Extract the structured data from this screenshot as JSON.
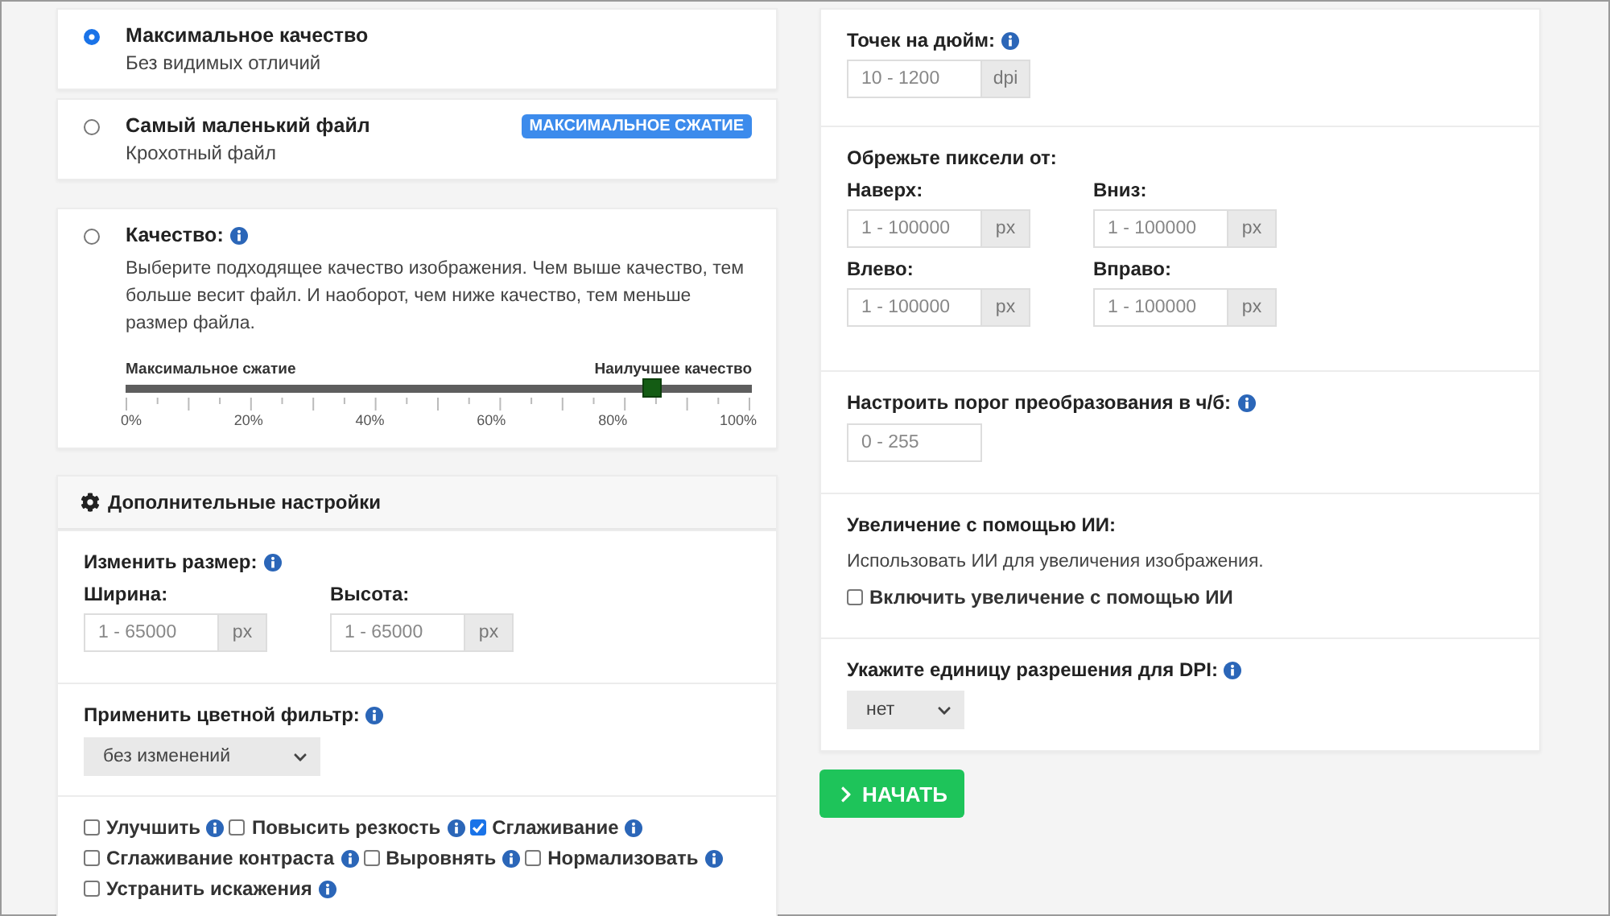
{
  "quality": {
    "options": [
      {
        "kind": "preset",
        "title": "Максимальное качество",
        "subtitle": "Без видимых отличий",
        "selected": true
      },
      {
        "kind": "preset",
        "title": "Самый маленький файл",
        "subtitle": "Крохотный файл",
        "badge": "МАКСИМАЛЬНОЕ СЖАТИЕ",
        "selected": false
      },
      {
        "kind": "custom",
        "title": "Качество:",
        "info": true,
        "description": "Выберите подходящее качество изображения. Чем выше качество, тем больше весит файл. И наоборот, чем ниже качество, тем меньше размер файла.",
        "slider": {
          "min_label": "Максимальное сжатие",
          "max_label": "Наилучшее качество",
          "level": 0.84,
          "scale": [
            "0%",
            "20%",
            "40%",
            "60%",
            "80%",
            "100%"
          ]
        },
        "selected": false
      }
    ]
  },
  "advanced": {
    "title": "Дополнительные настройки",
    "resize": {
      "label": "Изменить размер:",
      "info": true,
      "fields": [
        {
          "label": "Ширина:",
          "placeholder": "1 - 65000",
          "unit": "px"
        },
        {
          "label": "Высота:",
          "placeholder": "1 - 65000",
          "unit": "px"
        }
      ]
    },
    "color_filter": {
      "label": "Применить цветной фильтр:",
      "info": true,
      "value": "без изменений"
    },
    "options": [
      {
        "label": "Улучшить",
        "checked": false,
        "info": true
      },
      {
        "label": "Повысить резкость",
        "checked": false,
        "info": true
      },
      {
        "label": "Сглаживание",
        "checked": true,
        "info": true
      },
      {
        "label": "Сглаживание контраста",
        "checked": false,
        "info": true
      },
      {
        "label": "Выровнять",
        "checked": false,
        "info": true
      },
      {
        "label": "Нормализовать",
        "checked": false,
        "info": true
      },
      {
        "label": "Устранить искажения",
        "checked": false,
        "info": true
      }
    ]
  },
  "dpi": {
    "label": "Точек на дюйм:",
    "info": true,
    "placeholder": "10 - 1200",
    "unit": "dpi"
  },
  "crop": {
    "label": "Обрежьте пиксели от:",
    "fields": [
      {
        "label": "Наверх:",
        "placeholder": "1 - 100000",
        "unit": "px"
      },
      {
        "label": "Вниз:",
        "placeholder": "1 - 100000",
        "unit": "px"
      },
      {
        "label": "Влево:",
        "placeholder": "1 - 100000",
        "unit": "px"
      },
      {
        "label": "Вправо:",
        "placeholder": "1 - 100000",
        "unit": "px"
      }
    ]
  },
  "threshold": {
    "label": "Настроить порог преобразования в ч/б:",
    "info": true,
    "placeholder": "0 - 255"
  },
  "ai": {
    "title": "Увеличение с помощью ИИ:",
    "description": "Использовать ИИ для увеличения изображения.",
    "checkbox": {
      "label": "Включить увеличение с помощью ИИ",
      "checked": false
    }
  },
  "dpi_unit": {
    "label": "Укажите единицу разрешения для DPI:",
    "info": true,
    "value": "нет"
  },
  "start_button": {
    "label": "НАЧАТЬ"
  }
}
